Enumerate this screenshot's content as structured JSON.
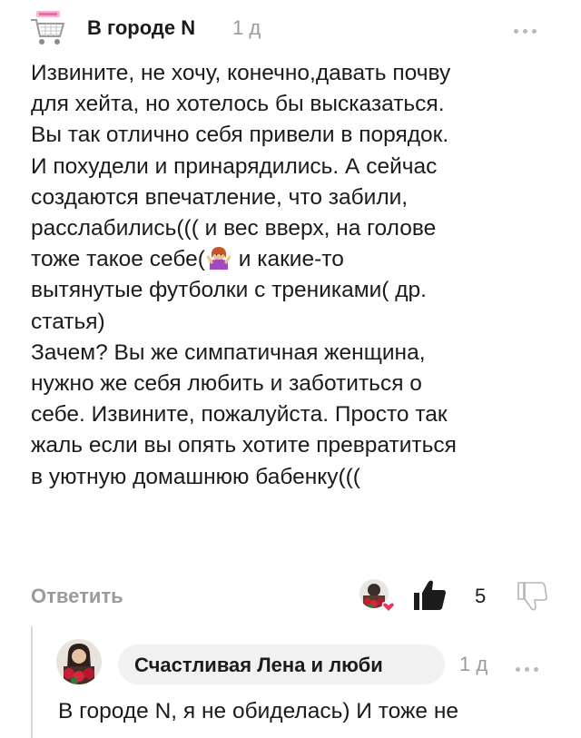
{
  "comment": {
    "author": "В городе N",
    "time": "1 д",
    "text_before_emoji": "Извините, не хочу, конечно,давать почву\nдля хейта, но хотелось бы высказаться.\nВы так отлично себя привели в порядок.\nИ похудели и принарядились. А сейчас\nсоздаются впечатление, что забили,\nрасслабились((( и вес вверх, на голове\nтоже такое себе(",
    "emoji": "shrugging-woman-emoji",
    "text_after_emoji": " и какие-то\nвытянутые футболки с трениками( др.\nстатья)\nЗачем? Вы же симпатичная женщина,\nнужно же себя любить и заботиться о\nсебе. Извините, пожалуйста. Просто так\nжаль если вы опять хотите превратиться\nв уютную домашнюю бабенку((("
  },
  "actions": {
    "reply_label": "Ответить",
    "like_count": "5"
  },
  "reply": {
    "author": "Счастливая Лена и люби",
    "time": "1 д",
    "text": "В городе N, я не обиделась) И тоже не"
  },
  "icons": {
    "more": "more-dots-icon",
    "like": "thumbs-up-icon",
    "dislike": "thumbs-down-icon",
    "heart": "heart-icon",
    "shop_avatar": "shopping-cart-icon"
  },
  "colors": {
    "text": "#1b1b1b",
    "muted": "#9b9b9b",
    "heart": "#e8395a",
    "pill": "#f1f1f1"
  }
}
